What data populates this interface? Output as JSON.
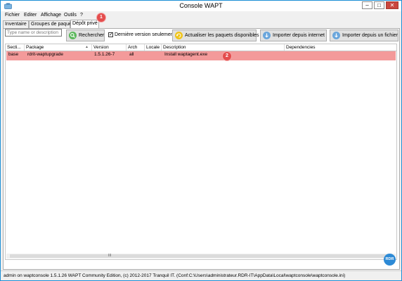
{
  "window": {
    "title": "Console WAPT",
    "controls": {
      "minimize": "–",
      "maximize": "□",
      "close": "✕"
    }
  },
  "menu": [
    "Fichier",
    "Editer",
    "Affichage",
    "Outils",
    "?"
  ],
  "tabs": [
    {
      "label": "Inventaire",
      "active": false
    },
    {
      "label": "Groupes de paquets",
      "active": false
    },
    {
      "label": "Dépôt privé",
      "active": true
    }
  ],
  "toolbar": {
    "search_placeholder": "Type name or description",
    "search_button": "Rechercher",
    "latest_checkbox_label": "Dernière version seulement",
    "latest_checked": true,
    "update_button": "Actualiser les paquets disponibles",
    "import_internet_button": "Importer depuis internet",
    "import_file_button": "Importer depuis un fichier"
  },
  "grid": {
    "columns": [
      "Secti...",
      "Package",
      "Version",
      "Arch",
      "Locale",
      "Description",
      "Dependencies"
    ],
    "rows": [
      {
        "section": "base",
        "package": "rdrit-waptupgrade",
        "version": "1.5.1.26-7",
        "arch": "all",
        "locale": "",
        "description": "Install waptagent.exe",
        "dependencies": ""
      }
    ],
    "sort_indicator": "▲",
    "scroll_grip": "III"
  },
  "annotations": [
    "1",
    "2"
  ],
  "logo_text": "RDR",
  "status": {
    "text": "admin on waptconsole 1.5.1.26 WAPT Community Edition, (c) 2012-2017 Tranquil IT. (Conf:C:\\Users\\administrateur.RDR-IT\\AppData\\Local\\waptconsole\\waptconsole.ini)"
  },
  "colors": {
    "accent": "#1c8fd6",
    "selected_row": "#f39a9a",
    "annotation_badge": "#e44d4d",
    "search_icon": "#5cb85c",
    "refresh_icon": "#f0c419",
    "import_icon": "#6aa6dc"
  },
  "icons": {
    "app": "wapt-app-icon",
    "search": "magnifier-icon",
    "refresh": "refresh-icon",
    "import_internet": "download-arrow-icon",
    "import_file": "download-arrow-icon"
  }
}
